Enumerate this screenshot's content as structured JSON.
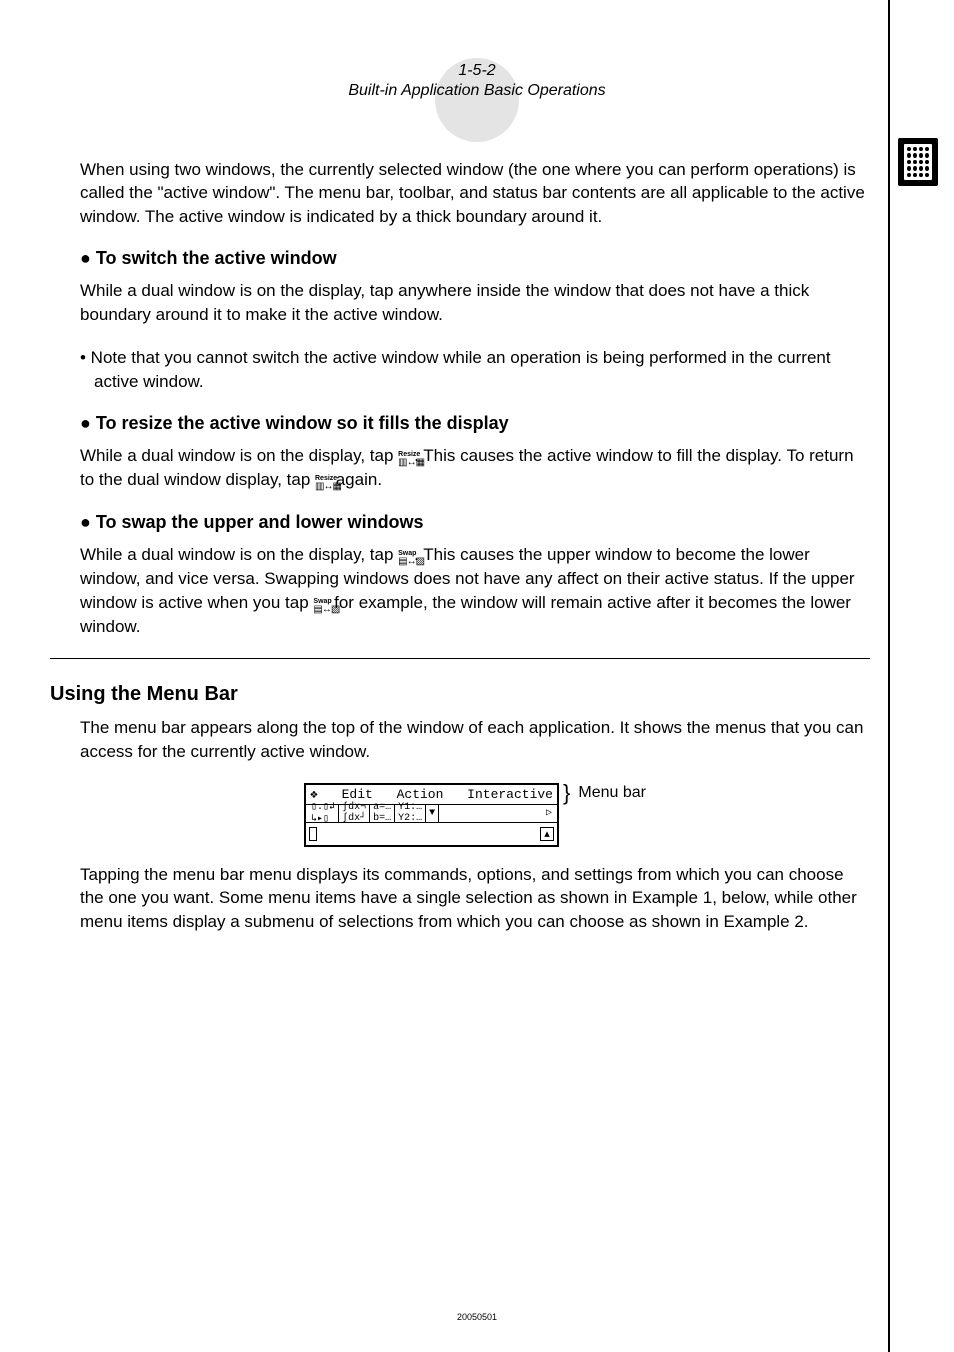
{
  "header": {
    "page_num": "1-5-2",
    "page_title": "Built-in Application Basic Operations"
  },
  "body": {
    "intro": "When using two windows, the currently selected window (the one where you can perform operations) is called the \"active window\". The menu bar, toolbar, and status bar contents are all applicable to the active window. The active window is indicated by a thick boundary around it.",
    "s1_head": "● To switch the active window",
    "s1_p1": "While a dual window is on the display, tap anywhere inside the window that does not have a thick boundary around it to make it the active window.",
    "s1_b1": "• Note that you cannot switch the active window while an operation is being performed in the current active window.",
    "s2_head": "● To resize the active window so it fills the display",
    "s2_p1a": "While a dual window is on the display, tap ",
    "s2_p1b": ". This causes the active window to fill the display. To return to the dual window display, tap ",
    "s2_p1c": " again.",
    "s3_head": "● To swap the upper and lower windows",
    "s3_p1a": "While a dual window is on the display, tap ",
    "s3_p1b": ". This causes the upper window to become the lower window, and vice versa. Swapping windows does not have any affect on their active status. If the upper window is active when you tap ",
    "s3_p1c": " for example, the window will remain active after it becomes the lower window.",
    "h2": "Using the Menu Bar",
    "mb_p1": "The menu bar appears along the top of the window of each application. It shows the menus that you can access for the currently active window.",
    "menubar": {
      "v": "❖",
      "edit": "Edit",
      "action": "Action",
      "interactive": "Interactive",
      "label": "Menu bar"
    },
    "mb_p2": "Tapping the menu bar menu displays its commands, options, and settings from which you can choose the one you want.  Some menu items have a single selection as shown in Example 1, below, while other menu items display a submenu of selections from which you can choose as shown in Example 2.",
    "icons": {
      "resize_label": "Resize",
      "resize_glyph": "▥↔▦",
      "swap_label": "Swap",
      "swap_glyph": "▤↔▧"
    }
  },
  "footer": {
    "code": "20050501"
  }
}
